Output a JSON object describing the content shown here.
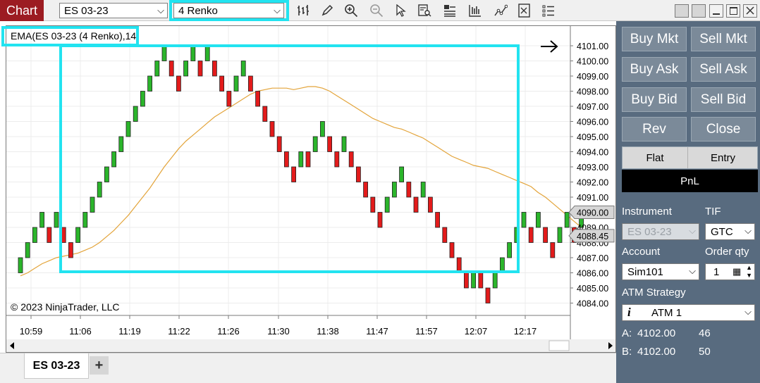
{
  "toolbar": {
    "chart_tab": "Chart",
    "instrument": "ES 03-23",
    "bar_type": "4 Renko",
    "icons": [
      "bar-style-icon",
      "pencil-icon",
      "zoom-in-icon",
      "zoom-out-icon",
      "pointer-icon",
      "data-box-icon",
      "panels-icon",
      "indicators-icon",
      "strategies-icon",
      "properties-icon",
      "menu-list-icon"
    ]
  },
  "chart": {
    "indicator_label": "EMA(ES 03-23 (4 Renko),14)",
    "copyright": "© 2023 NinjaTrader, LLC",
    "time_labels": [
      "10:59",
      "11:06",
      "11:19",
      "11:22",
      "11:26",
      "11:30",
      "11:38",
      "11:47",
      "11:57",
      "12:07",
      "12:17"
    ],
    "price_labels": [
      "4101.00",
      "4100.00",
      "4099.00",
      "4098.00",
      "4097.00",
      "4096.00",
      "4095.00",
      "4094.00",
      "4093.00",
      "4092.00",
      "4091.00",
      "4090.00",
      "4089.00",
      "4088.00",
      "4087.00",
      "4086.00",
      "4085.00",
      "4084.00"
    ],
    "last_price_tag": "4090.00",
    "ema_tag": "4088.45",
    "colors": {
      "up": "#2bb52b",
      "down": "#e31b1b",
      "ema": "#e3a43a",
      "highlight": "#22e3f0"
    }
  },
  "chart_data": {
    "type": "renko",
    "brick_size": 1,
    "ylim": [
      4083.5,
      4101.5
    ],
    "bricks": [
      {
        "o": 4086,
        "c": 4087
      },
      {
        "o": 4087,
        "c": 4088
      },
      {
        "o": 4088,
        "c": 4089
      },
      {
        "o": 4089,
        "c": 4090
      },
      {
        "o": 4089,
        "c": 4088
      },
      {
        "o": 4089,
        "c": 4090
      },
      {
        "o": 4089,
        "c": 4088
      },
      {
        "o": 4088,
        "c": 4087
      },
      {
        "o": 4088,
        "c": 4089
      },
      {
        "o": 4089,
        "c": 4090
      },
      {
        "o": 4090,
        "c": 4091
      },
      {
        "o": 4091,
        "c": 4092
      },
      {
        "o": 4092,
        "c": 4093
      },
      {
        "o": 4093,
        "c": 4094
      },
      {
        "o": 4094,
        "c": 4095
      },
      {
        "o": 4095,
        "c": 4096
      },
      {
        "o": 4096,
        "c": 4097
      },
      {
        "o": 4097,
        "c": 4098
      },
      {
        "o": 4098,
        "c": 4099
      },
      {
        "o": 4099,
        "c": 4100
      },
      {
        "o": 4100,
        "c": 4101
      },
      {
        "o": 4100,
        "c": 4099
      },
      {
        "o": 4099,
        "c": 4098
      },
      {
        "o": 4099,
        "c": 4100
      },
      {
        "o": 4100,
        "c": 4101
      },
      {
        "o": 4100,
        "c": 4099
      },
      {
        "o": 4100,
        "c": 4101
      },
      {
        "o": 4100,
        "c": 4099
      },
      {
        "o": 4099,
        "c": 4098
      },
      {
        "o": 4098,
        "c": 4097
      },
      {
        "o": 4098,
        "c": 4099
      },
      {
        "o": 4099,
        "c": 4100
      },
      {
        "o": 4099,
        "c": 4098
      },
      {
        "o": 4098,
        "c": 4097
      },
      {
        "o": 4097,
        "c": 4096
      },
      {
        "o": 4096,
        "c": 4095
      },
      {
        "o": 4095,
        "c": 4094
      },
      {
        "o": 4094,
        "c": 4093
      },
      {
        "o": 4093,
        "c": 4092
      },
      {
        "o": 4093,
        "c": 4094
      },
      {
        "o": 4094,
        "c": 4093
      },
      {
        "o": 4094,
        "c": 4095
      },
      {
        "o": 4095,
        "c": 4096
      },
      {
        "o": 4095,
        "c": 4094
      },
      {
        "o": 4094,
        "c": 4093
      },
      {
        "o": 4094,
        "c": 4095
      },
      {
        "o": 4094,
        "c": 4093
      },
      {
        "o": 4093,
        "c": 4092
      },
      {
        "o": 4092,
        "c": 4091
      },
      {
        "o": 4091,
        "c": 4090
      },
      {
        "o": 4090,
        "c": 4089
      },
      {
        "o": 4090,
        "c": 4091
      },
      {
        "o": 4091,
        "c": 4092
      },
      {
        "o": 4092,
        "c": 4093
      },
      {
        "o": 4092,
        "c": 4091
      },
      {
        "o": 4091,
        "c": 4090
      },
      {
        "o": 4091,
        "c": 4092
      },
      {
        "o": 4091,
        "c": 4090
      },
      {
        "o": 4090,
        "c": 4089
      },
      {
        "o": 4089,
        "c": 4088
      },
      {
        "o": 4088,
        "c": 4087
      },
      {
        "o": 4087,
        "c": 4086
      },
      {
        "o": 4086,
        "c": 4085
      },
      {
        "o": 4085,
        "c": 4086
      },
      {
        "o": 4086,
        "c": 4085
      },
      {
        "o": 4085,
        "c": 4084
      },
      {
        "o": 4085,
        "c": 4086
      },
      {
        "o": 4086,
        "c": 4087
      },
      {
        "o": 4087,
        "c": 4088
      },
      {
        "o": 4088,
        "c": 4089
      },
      {
        "o": 4089,
        "c": 4090
      },
      {
        "o": 4089,
        "c": 4088
      },
      {
        "o": 4089,
        "c": 4090
      },
      {
        "o": 4089,
        "c": 4088
      },
      {
        "o": 4088,
        "c": 4087
      },
      {
        "o": 4088,
        "c": 4089
      },
      {
        "o": 4089,
        "c": 4090
      },
      {
        "o": 4089,
        "c": 4088
      },
      {
        "o": 4089,
        "c": 4090
      }
    ],
    "ema": [
      4085.8,
      4086.0,
      4086.3,
      4086.6,
      4086.8,
      4087.0,
      4087.1,
      4087.2,
      4087.3,
      4087.5,
      4087.7,
      4088.0,
      4088.4,
      4088.8,
      4089.3,
      4089.8,
      4090.4,
      4091.0,
      4091.6,
      4092.3,
      4093.0,
      4093.6,
      4094.2,
      4094.7,
      4095.1,
      4095.5,
      4095.9,
      4096.3,
      4096.6,
      4096.9,
      4097.2,
      4097.5,
      4097.8,
      4098.0,
      4098.1,
      4098.2,
      4098.2,
      4098.2,
      4098.1,
      4098.2,
      4098.3,
      4098.3,
      4098.2,
      4098.0,
      4097.7,
      4097.4,
      4097.1,
      4096.8,
      4096.5,
      4096.2,
      4096.0,
      4095.8,
      4095.6,
      4095.5,
      4095.3,
      4095.1,
      4094.9,
      4094.6,
      4094.3,
      4094.0,
      4093.7,
      4093.5,
      4093.3,
      4093.1,
      4093.0,
      4092.9,
      4092.7,
      4092.5,
      4092.3,
      4092.1,
      4091.9,
      4091.7,
      4091.3,
      4091.0,
      4090.6,
      4090.2,
      4089.8,
      4089.4,
      4089.0
    ]
  },
  "panel": {
    "buttons": [
      "Buy Mkt",
      "Sell Mkt",
      "Buy Ask",
      "Sell Ask",
      "Buy Bid",
      "Sell Bid",
      "Rev",
      "Close"
    ],
    "flat": "Flat",
    "entry": "Entry",
    "pnl": "PnL",
    "instrument_label": "Instrument",
    "tif_label": "TIF",
    "instrument_value": "ES 03-23",
    "tif_value": "GTC",
    "account_label": "Account",
    "qty_label": "Order qty",
    "account_value": "Sim101",
    "qty_value": "1",
    "atm_label": "ATM Strategy",
    "atm_value": "ATM 1",
    "ask_label": "A:",
    "ask_price": "4102.00",
    "ask_size": "46",
    "bid_label": "B:",
    "bid_price": "4102.00",
    "bid_size": "50"
  },
  "bottom": {
    "tab": "ES 03-23",
    "add": "+"
  }
}
